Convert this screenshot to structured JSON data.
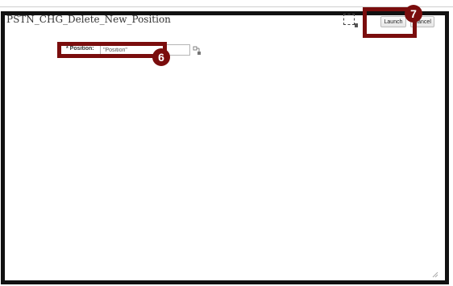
{
  "dialog": {
    "title": "PSTN_CHG_Delete_New_Position",
    "launch_label": "Launch",
    "cancel_label": "Cancel"
  },
  "form": {
    "position_label": "* Position:",
    "position_value": "\"Position\""
  },
  "callouts": {
    "step6": "6",
    "step7": "7",
    "color": "#7a0d0d"
  },
  "icons": {
    "personalize": "dotted-selection-icon",
    "lookup": "lookup-icon",
    "resize": "resize-grip-icon"
  }
}
